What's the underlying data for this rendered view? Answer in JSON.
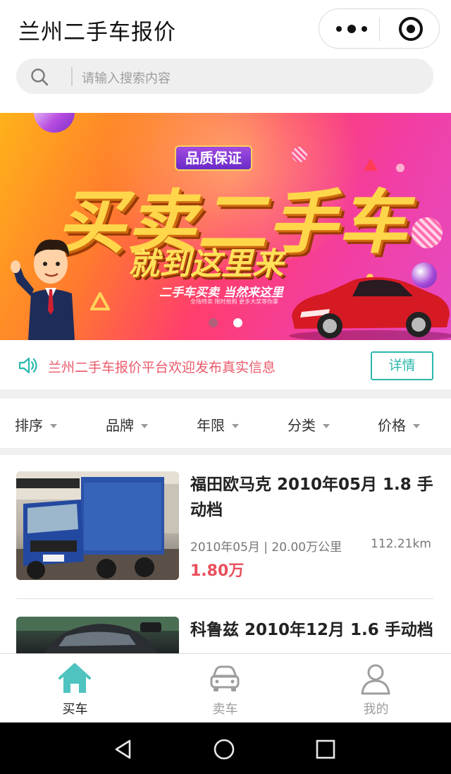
{
  "header": {
    "title": "兰州二手车报价",
    "more_icon": "more-dots-icon",
    "close_icon": "miniprogram-target-icon"
  },
  "search": {
    "placeholder": "请输入搜索内容",
    "icon": "search-icon"
  },
  "banner": {
    "badge": "品质保证",
    "headline": "买卖二手车",
    "subheadline": "就到这里来",
    "tagline": "二手车买卖 当然来这里",
    "fineprint": "全场特卖 限时抢购 更多大奖等你拿",
    "slide_count": 2,
    "active_slide": 2,
    "colors": {
      "dot_inactive": "#b0607a",
      "dot_active": "#ffffff"
    }
  },
  "notice": {
    "icon": "speaker-icon",
    "text": "兰州二手车报价平台欢迎发布真实信息",
    "button_label": "详情",
    "colors": {
      "text": "#ea5a6a",
      "accent": "#2bb8ad"
    }
  },
  "filters": [
    {
      "label": "排序"
    },
    {
      "label": "品牌"
    },
    {
      "label": "年限"
    },
    {
      "label": "分类"
    },
    {
      "label": "价格"
    }
  ],
  "listings": [
    {
      "title": "福田欧马克 2010年05月 1.8 手动档",
      "meta": "2010年05月 | 20.00万公里",
      "distance": "112.21km",
      "price": "1.80万"
    },
    {
      "title": "科鲁兹 2010年12月 1.6 手动档"
    }
  ],
  "tabbar": [
    {
      "label": "买车",
      "icon": "home-icon",
      "active": true
    },
    {
      "label": "卖车",
      "icon": "car-icon",
      "active": false
    },
    {
      "label": "我的",
      "icon": "user-icon",
      "active": false
    }
  ],
  "tab_colors": {
    "active_icon": "#4ec3c0",
    "active_label": "#222222",
    "inactive": "#9e9e9e"
  },
  "system_nav": [
    "back-icon",
    "home-circle-icon",
    "recents-icon"
  ]
}
